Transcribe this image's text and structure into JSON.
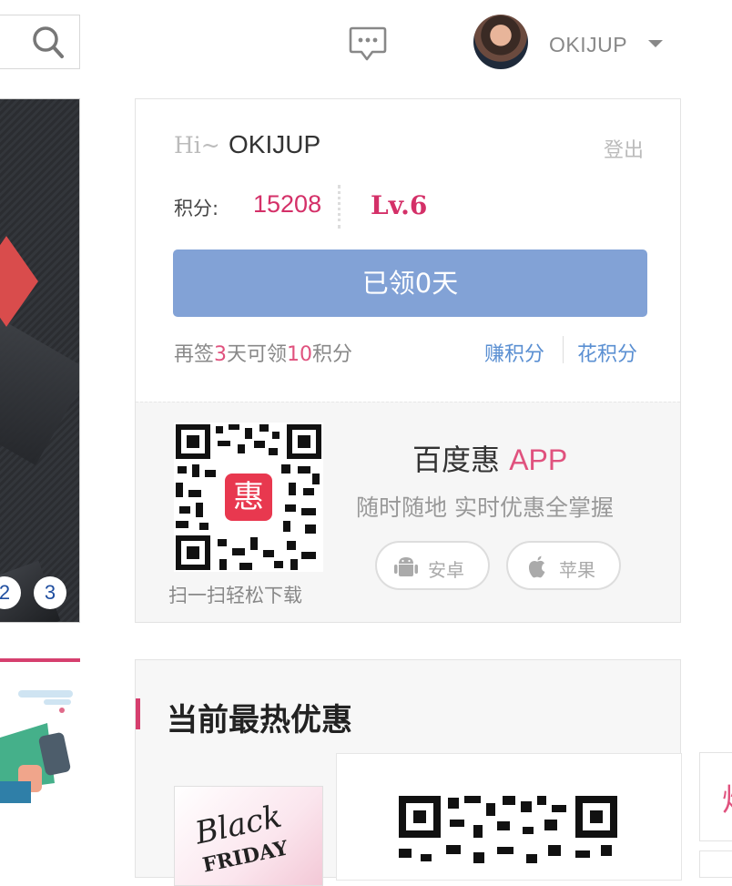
{
  "header": {
    "username": "OKIJUP"
  },
  "banner": {
    "pager": [
      "2",
      "3"
    ]
  },
  "user_card": {
    "greeting": "Hi~",
    "name": "OKIJUP",
    "logout": "登出",
    "points_label": "积分:",
    "points_value": "15208",
    "level": "Lv.6",
    "checkin_button": "已领0天",
    "sign_tip_parts": [
      "再签",
      "3",
      "天可领",
      "10",
      "积分"
    ],
    "earn_points": "赚积分",
    "spend_points": "花积分"
  },
  "app_promo": {
    "scan_tip": "扫一扫轻松下载",
    "title": "百度惠",
    "title_suffix": "APP",
    "subtitle": "随时随地 实时优惠全掌握",
    "android_label": "安卓",
    "ios_label": "苹果",
    "qr_center_glyph": "惠"
  },
  "hot_deals": {
    "title": "当前最热优惠",
    "deal_image_text": "Black",
    "deal_image_text2": "FRIDAY",
    "side_glyph": "炒"
  },
  "colors": {
    "accent": "#d43068",
    "button": "#82a2d6",
    "link": "#5a8fd2"
  }
}
